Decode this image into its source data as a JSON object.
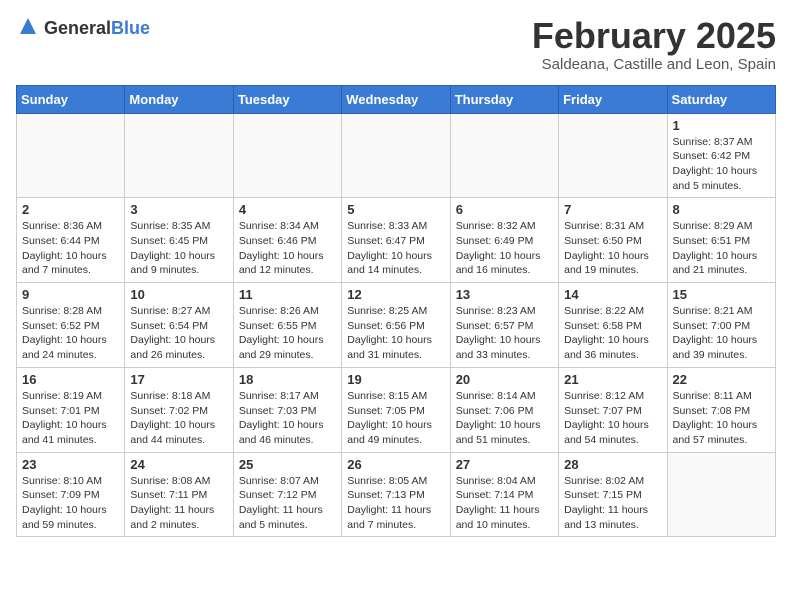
{
  "header": {
    "logo_general": "General",
    "logo_blue": "Blue",
    "month_year": "February 2025",
    "location": "Saldeana, Castille and Leon, Spain"
  },
  "days_of_week": [
    "Sunday",
    "Monday",
    "Tuesday",
    "Wednesday",
    "Thursday",
    "Friday",
    "Saturday"
  ],
  "weeks": [
    [
      {
        "day": "",
        "info": ""
      },
      {
        "day": "",
        "info": ""
      },
      {
        "day": "",
        "info": ""
      },
      {
        "day": "",
        "info": ""
      },
      {
        "day": "",
        "info": ""
      },
      {
        "day": "",
        "info": ""
      },
      {
        "day": "1",
        "info": "Sunrise: 8:37 AM\nSunset: 6:42 PM\nDaylight: 10 hours\nand 5 minutes."
      }
    ],
    [
      {
        "day": "2",
        "info": "Sunrise: 8:36 AM\nSunset: 6:44 PM\nDaylight: 10 hours\nand 7 minutes."
      },
      {
        "day": "3",
        "info": "Sunrise: 8:35 AM\nSunset: 6:45 PM\nDaylight: 10 hours\nand 9 minutes."
      },
      {
        "day": "4",
        "info": "Sunrise: 8:34 AM\nSunset: 6:46 PM\nDaylight: 10 hours\nand 12 minutes."
      },
      {
        "day": "5",
        "info": "Sunrise: 8:33 AM\nSunset: 6:47 PM\nDaylight: 10 hours\nand 14 minutes."
      },
      {
        "day": "6",
        "info": "Sunrise: 8:32 AM\nSunset: 6:49 PM\nDaylight: 10 hours\nand 16 minutes."
      },
      {
        "day": "7",
        "info": "Sunrise: 8:31 AM\nSunset: 6:50 PM\nDaylight: 10 hours\nand 19 minutes."
      },
      {
        "day": "8",
        "info": "Sunrise: 8:29 AM\nSunset: 6:51 PM\nDaylight: 10 hours\nand 21 minutes."
      }
    ],
    [
      {
        "day": "9",
        "info": "Sunrise: 8:28 AM\nSunset: 6:52 PM\nDaylight: 10 hours\nand 24 minutes."
      },
      {
        "day": "10",
        "info": "Sunrise: 8:27 AM\nSunset: 6:54 PM\nDaylight: 10 hours\nand 26 minutes."
      },
      {
        "day": "11",
        "info": "Sunrise: 8:26 AM\nSunset: 6:55 PM\nDaylight: 10 hours\nand 29 minutes."
      },
      {
        "day": "12",
        "info": "Sunrise: 8:25 AM\nSunset: 6:56 PM\nDaylight: 10 hours\nand 31 minutes."
      },
      {
        "day": "13",
        "info": "Sunrise: 8:23 AM\nSunset: 6:57 PM\nDaylight: 10 hours\nand 33 minutes."
      },
      {
        "day": "14",
        "info": "Sunrise: 8:22 AM\nSunset: 6:58 PM\nDaylight: 10 hours\nand 36 minutes."
      },
      {
        "day": "15",
        "info": "Sunrise: 8:21 AM\nSunset: 7:00 PM\nDaylight: 10 hours\nand 39 minutes."
      }
    ],
    [
      {
        "day": "16",
        "info": "Sunrise: 8:19 AM\nSunset: 7:01 PM\nDaylight: 10 hours\nand 41 minutes."
      },
      {
        "day": "17",
        "info": "Sunrise: 8:18 AM\nSunset: 7:02 PM\nDaylight: 10 hours\nand 44 minutes."
      },
      {
        "day": "18",
        "info": "Sunrise: 8:17 AM\nSunset: 7:03 PM\nDaylight: 10 hours\nand 46 minutes."
      },
      {
        "day": "19",
        "info": "Sunrise: 8:15 AM\nSunset: 7:05 PM\nDaylight: 10 hours\nand 49 minutes."
      },
      {
        "day": "20",
        "info": "Sunrise: 8:14 AM\nSunset: 7:06 PM\nDaylight: 10 hours\nand 51 minutes."
      },
      {
        "day": "21",
        "info": "Sunrise: 8:12 AM\nSunset: 7:07 PM\nDaylight: 10 hours\nand 54 minutes."
      },
      {
        "day": "22",
        "info": "Sunrise: 8:11 AM\nSunset: 7:08 PM\nDaylight: 10 hours\nand 57 minutes."
      }
    ],
    [
      {
        "day": "23",
        "info": "Sunrise: 8:10 AM\nSunset: 7:09 PM\nDaylight: 10 hours\nand 59 minutes."
      },
      {
        "day": "24",
        "info": "Sunrise: 8:08 AM\nSunset: 7:11 PM\nDaylight: 11 hours\nand 2 minutes."
      },
      {
        "day": "25",
        "info": "Sunrise: 8:07 AM\nSunset: 7:12 PM\nDaylight: 11 hours\nand 5 minutes."
      },
      {
        "day": "26",
        "info": "Sunrise: 8:05 AM\nSunset: 7:13 PM\nDaylight: 11 hours\nand 7 minutes."
      },
      {
        "day": "27",
        "info": "Sunrise: 8:04 AM\nSunset: 7:14 PM\nDaylight: 11 hours\nand 10 minutes."
      },
      {
        "day": "28",
        "info": "Sunrise: 8:02 AM\nSunset: 7:15 PM\nDaylight: 11 hours\nand 13 minutes."
      },
      {
        "day": "",
        "info": ""
      }
    ]
  ]
}
